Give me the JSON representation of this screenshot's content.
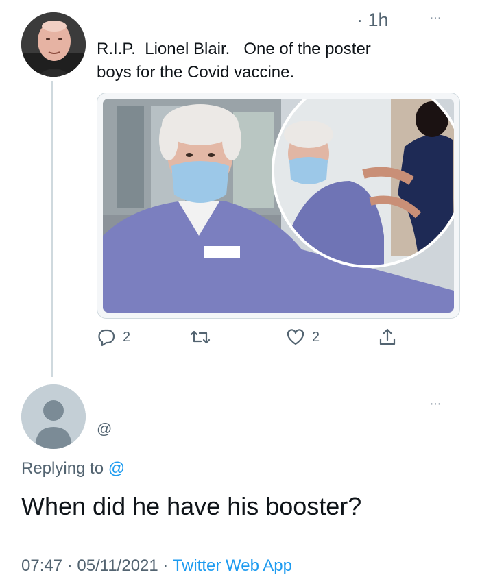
{
  "tweet": {
    "time": "· 1h",
    "more": "···",
    "text": "R.I.P.  Lionel Blair.   One of the poster\nboys for the Covid vaccine.",
    "actions": {
      "replies": "2",
      "likes": "2"
    }
  },
  "reply": {
    "more": "···",
    "handle": "@",
    "replying_label": "Replying to ",
    "replying_mention": "@",
    "text": "When did he have his booster?",
    "time": "07:47",
    "date": "05/11/2021",
    "separator": "·",
    "app": "Twitter Web App"
  },
  "colors": {
    "accent": "#1d9bf0",
    "secondary_text": "#536471",
    "thread_line": "#cfd9de"
  },
  "icons": [
    "reply-icon",
    "retweet-icon",
    "like-icon",
    "share-icon",
    "more-icon",
    "default-avatar-icon"
  ]
}
